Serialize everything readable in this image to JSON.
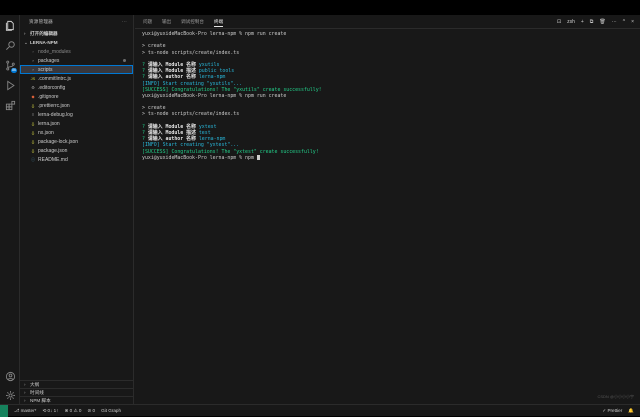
{
  "colors": {
    "accent": "#0078d4",
    "remote": "#16825d",
    "success": "#23d18b",
    "info": "#29b8db"
  },
  "activity": [
    {
      "icon": "files-icon",
      "badge": ""
    },
    {
      "icon": "search-icon",
      "badge": ""
    },
    {
      "icon": "source-control-icon",
      "badge": ""
    },
    {
      "icon": "run-debug-icon",
      "badge": ""
    },
    {
      "icon": "extensions-icon",
      "badge": ""
    }
  ],
  "activity_bottom": [
    {
      "icon": "account-icon"
    },
    {
      "icon": "settings-gear-icon"
    }
  ],
  "sidebar": {
    "title": "资源管理器",
    "more": "···",
    "open_editors": "打开的编辑器",
    "project": "LERNA-NPM",
    "items": [
      {
        "label": "node_modules",
        "icon": "›",
        "dim": true
      },
      {
        "label": "packages",
        "icon": "›",
        "dim": false,
        "dot": true
      },
      {
        "label": "scripts",
        "icon": "›",
        "dim": false,
        "selected": true
      },
      {
        "label": ".commitlintrc.js",
        "icon": "JS",
        "dim": false
      },
      {
        "label": ".editorconfig",
        "icon": "⚙",
        "dim": false
      },
      {
        "label": ".gitignore",
        "icon": "◆",
        "dim": false
      },
      {
        "label": ".prettierrc.json",
        "icon": "{}",
        "dim": false
      },
      {
        "label": "lerna-debug.log",
        "icon": "≡",
        "dim": false
      },
      {
        "label": "lerna.json",
        "icon": "{}",
        "dim": false
      },
      {
        "label": "nx.json",
        "icon": "{}",
        "dim": false
      },
      {
        "label": "package-lock.json",
        "icon": "{}",
        "dim": false
      },
      {
        "label": "package.json",
        "icon": "{}",
        "dim": false
      },
      {
        "label": "README.md",
        "icon": "ⓘ",
        "dim": false
      }
    ],
    "bottom": [
      "大纲",
      "时间线",
      "NPM 脚本"
    ]
  },
  "panel": {
    "tabs": [
      "问题",
      "输出",
      "调试控制台",
      "终端"
    ],
    "active_tab": 3,
    "terminal_name": "zsh",
    "new_terminal": "+",
    "split": "⧉",
    "trash": "🗑",
    "more": "···",
    "max": "^",
    "close": "×"
  },
  "terminal": [
    [
      {
        "t": "yuxi@yuxideMacBook-Pro lerna-npm % npm run create",
        "c": ""
      }
    ],
    [
      {
        "t": "",
        "c": ""
      }
    ],
    [
      {
        "t": "> create",
        "c": ""
      }
    ],
    [
      {
        "t": "> ts-node scripts/create/index.ts",
        "c": ""
      }
    ],
    [
      {
        "t": "",
        "c": ""
      }
    ],
    [
      {
        "t": "? ",
        "c": "c-green"
      },
      {
        "t": "请输入 Module 名称 ",
        "c": "c-white"
      },
      {
        "t": "yxutils",
        "c": "c-cyan"
      }
    ],
    [
      {
        "t": "? ",
        "c": "c-green"
      },
      {
        "t": "请输入 Module 描述 ",
        "c": "c-white"
      },
      {
        "t": "public tools",
        "c": "c-cyan"
      }
    ],
    [
      {
        "t": "? ",
        "c": "c-green"
      },
      {
        "t": "请输入 author 名称 ",
        "c": "c-white"
      },
      {
        "t": "lerna-npm",
        "c": "c-cyan"
      }
    ],
    [
      {
        "t": "[INFO] Start creating \"yxutils\"...",
        "c": "c-cyan"
      }
    ],
    [
      {
        "t": "[SUCCESS] Congratulations! The \"yxutils\" create successfully!",
        "c": "c-green"
      }
    ],
    [
      {
        "t": "yuxi@yuxideMacBook-Pro lerna-npm % npm run create",
        "c": ""
      }
    ],
    [
      {
        "t": "",
        "c": ""
      }
    ],
    [
      {
        "t": "> create",
        "c": ""
      }
    ],
    [
      {
        "t": "> ts-node scripts/create/index.ts",
        "c": ""
      }
    ],
    [
      {
        "t": "",
        "c": ""
      }
    ],
    [
      {
        "t": "? ",
        "c": "c-green"
      },
      {
        "t": "请输入 Module 名称 ",
        "c": "c-white"
      },
      {
        "t": "yxtest",
        "c": "c-cyan"
      }
    ],
    [
      {
        "t": "? ",
        "c": "c-green"
      },
      {
        "t": "请输入 Module 描述 ",
        "c": "c-white"
      },
      {
        "t": "test",
        "c": "c-cyan"
      }
    ],
    [
      {
        "t": "? ",
        "c": "c-green"
      },
      {
        "t": "请输入 author 名称 ",
        "c": "c-white"
      },
      {
        "t": "lerna-npm",
        "c": "c-cyan"
      }
    ],
    [
      {
        "t": "[INFO] Start creating \"yxtest\"...",
        "c": "c-cyan"
      }
    ],
    [
      {
        "t": "[SUCCESS] Congratulations! The \"yxtest\" create successfully!",
        "c": "c-green"
      }
    ],
    [
      {
        "t": "yuxi@yuxideMacBook-Pro lerna-npm % npm ",
        "c": ""
      }
    ]
  ],
  "status": {
    "branch": "master*",
    "sync": "⟲ 0↓ 1↑",
    "problems": "⊗ 0 ⚠ 0",
    "ports": "⊘ 0",
    "git_graph": "Git Graph",
    "prettier": "✓ Prettier",
    "notifications": "🔔"
  },
  "watermark": "CSDN @小小小小宇"
}
